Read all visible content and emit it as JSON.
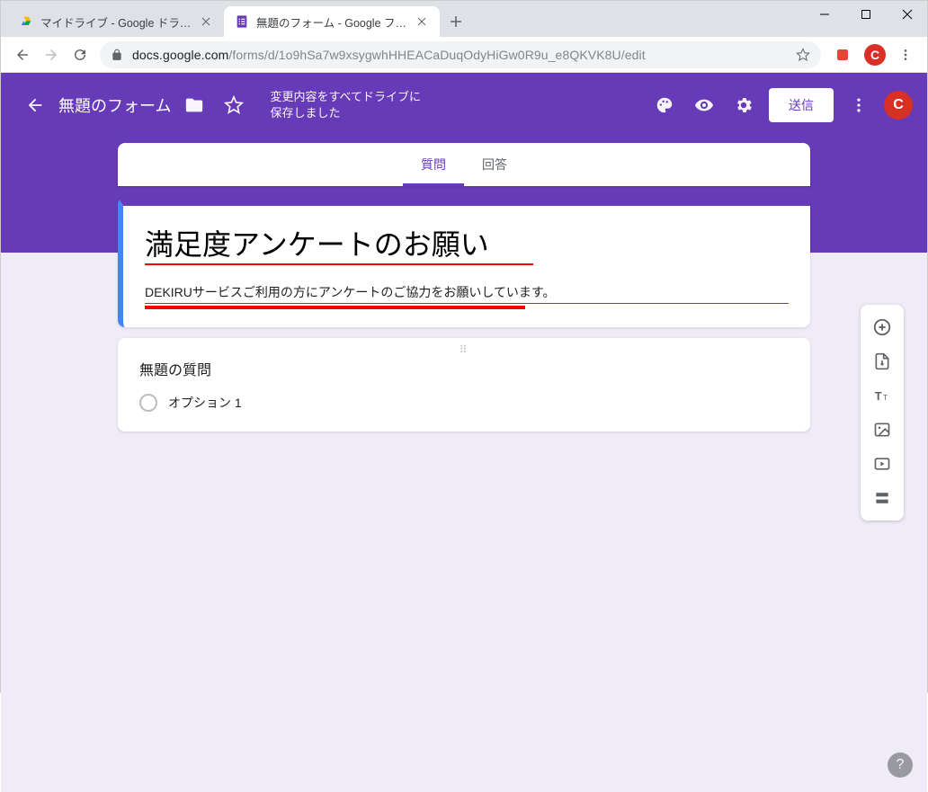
{
  "window": {
    "tabs": [
      {
        "title": "マイドライブ - Google ドライブ",
        "active": false
      },
      {
        "title": "無題のフォーム - Google フォーム",
        "active": true
      }
    ]
  },
  "url": {
    "host": "docs.google.com",
    "path": "/forms/d/1o9hSa7w9xsygwhHHEACaDuqOdyHiGw0R9u_e8QKVK8U/edit"
  },
  "header": {
    "title": "無題のフォーム",
    "save_status_line1": "変更内容をすべてドライブに",
    "save_status_line2": "保存しました",
    "send_label": "送信"
  },
  "form_tabs": {
    "questions": "質問",
    "responses": "回答"
  },
  "form": {
    "title": "満足度アンケートのお願い",
    "description": "DEKIRUサービスご利用の方にアンケートのご協力をお願いしています。"
  },
  "question": {
    "title": "無題の質問",
    "option1": "オプション 1"
  },
  "help": "?"
}
